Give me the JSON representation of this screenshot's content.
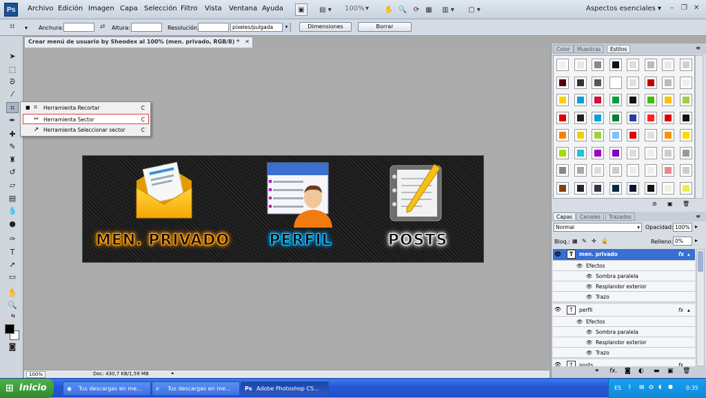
{
  "menubar": {
    "logo": "Ps",
    "items": [
      "Archivo",
      "Edición",
      "Imagen",
      "Capa",
      "Selección",
      "Filtro",
      "Vista",
      "Ventana",
      "Ayuda"
    ],
    "zoom": "100%",
    "workspace": "Aspectos esenciales"
  },
  "options": {
    "width_label": "Anchura:",
    "height_label": "Altura:",
    "resolution_label": "Resolución:",
    "resolution_unit": "píxeles/pulgada",
    "dimensions_button": "Dimensiones",
    "clear_button": "Borrar"
  },
  "document": {
    "tab_title": "Crear menú de usuario by Sheodex al 100% (men. privado, RGB/8) *",
    "zoom": "100%",
    "doc_info": "Doc: 430,7 KB/1,59 MB"
  },
  "flyout": {
    "items": [
      {
        "label": "Herramienta Recortar",
        "key": "C"
      },
      {
        "label": "Herramienta Sector",
        "key": "C"
      },
      {
        "label": "Herramienta Seleccionar sector",
        "key": "C"
      }
    ]
  },
  "banner": {
    "items": [
      "MEN. PRIVADO",
      "PERFIL",
      "POSTS"
    ],
    "glow_colors": [
      "#ff9a00",
      "#00b4ff",
      "#ffffff"
    ]
  },
  "styles_panel": {
    "tabs": [
      "Color",
      "Muestras",
      "Estilos"
    ]
  },
  "layers_panel": {
    "tabs": [
      "Capas",
      "Canales",
      "Trazados"
    ],
    "blend_mode": "Normal",
    "opacity_label": "Opacidad:",
    "opacity_value": "100%",
    "lock_label": "Bloq.:",
    "fill_label": "Relleno:",
    "fill_value": "0%",
    "layers": [
      {
        "name": "men. privado",
        "effects_label": "Efectos",
        "effects": [
          "Sombra paralela",
          "Resplandor exterior",
          "Trazo"
        ]
      },
      {
        "name": "perfil",
        "effects_label": "Efectos",
        "effects": [
          "Sombra paralela",
          "Resplandor exterior",
          "Trazo"
        ]
      },
      {
        "name": "posts"
      }
    ]
  },
  "taskbar": {
    "start": "Inicio",
    "tasks": [
      "Tus descargas en me...",
      "Tus descargas en me...",
      "Adobe Photoshop CS..."
    ],
    "lang": "ES",
    "clock": "0:35"
  }
}
